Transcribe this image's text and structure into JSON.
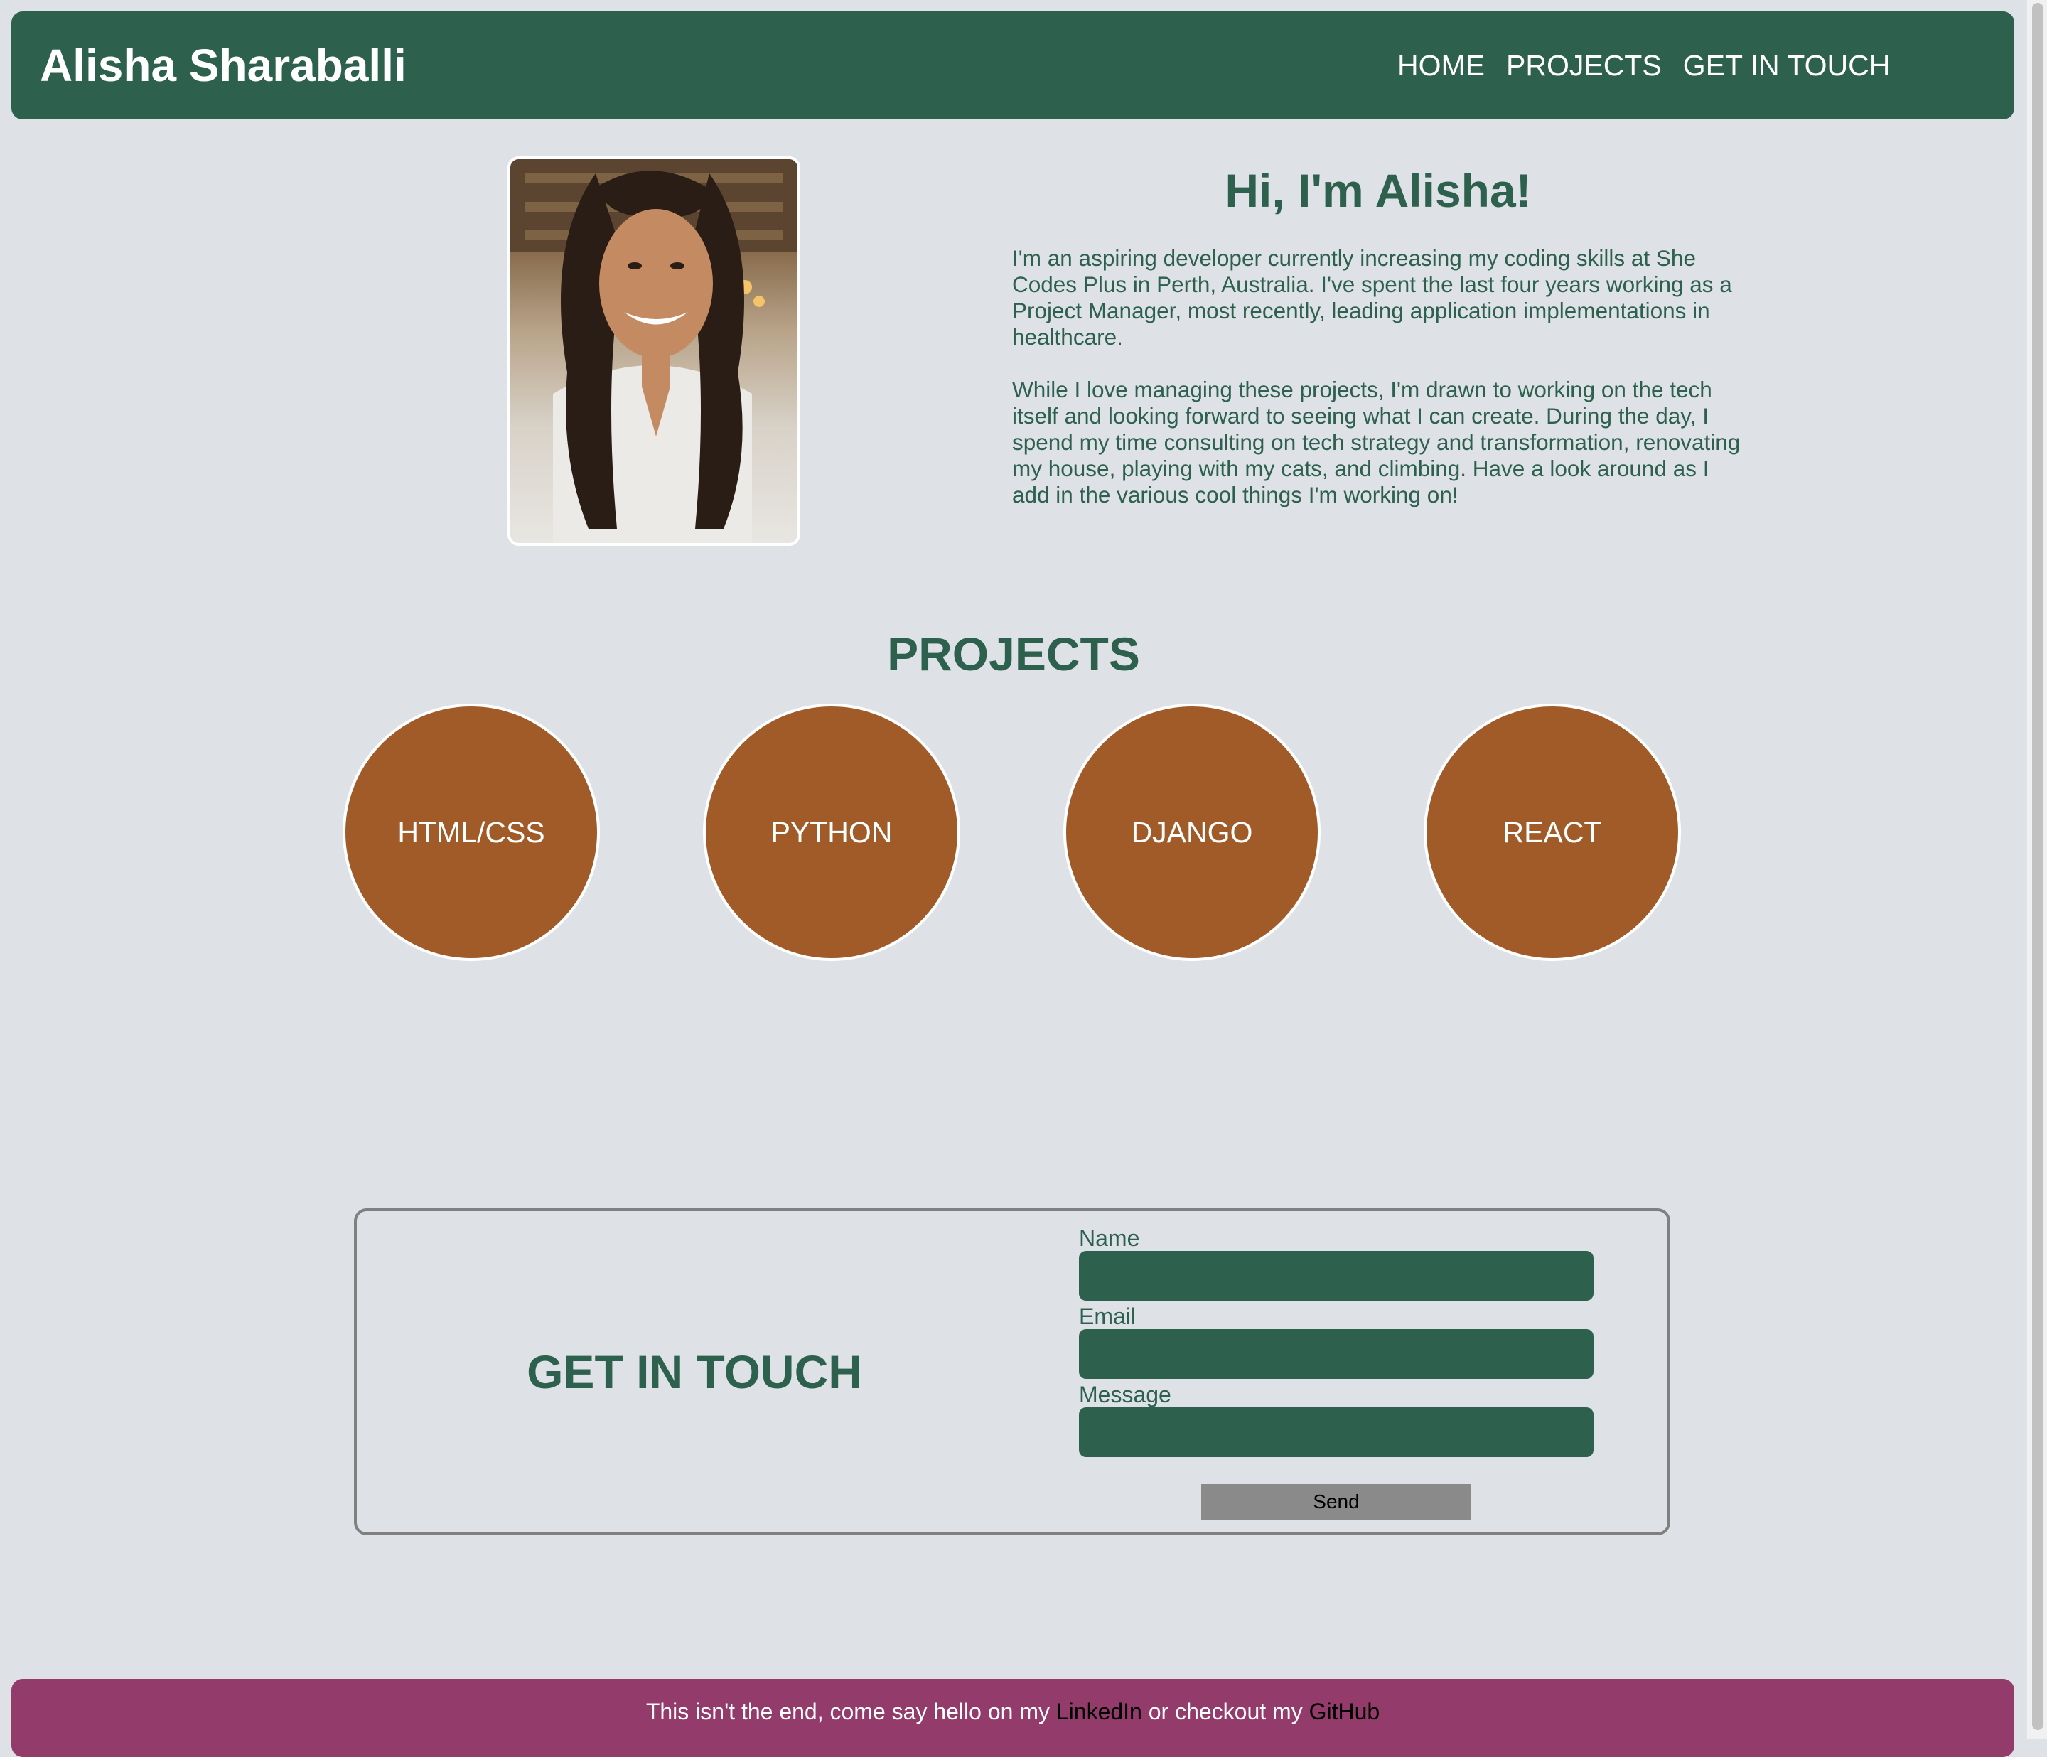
{
  "header": {
    "brand": "Alisha Sharaballi",
    "nav": [
      "HOME",
      "PROJECTS",
      "GET IN TOUCH"
    ]
  },
  "intro": {
    "heading": "Hi, I'm Alisha!",
    "paragraphs": [
      "I'm an aspiring developer currently increasing my coding skills at She Codes Plus in Perth, Australia. I've spent the last four years working as a Project Manager, most recently, leading application implementations in healthcare.",
      "While I love managing these projects, I'm drawn to working on the tech itself and looking forward to seeing what I can create. During the day, I spend my time consulting on tech strategy and transformation, renovating my house, playing with my cats, and climbing. Have a look around as I add in the various cool things I'm working on!"
    ]
  },
  "projects": {
    "title": "PROJECTS",
    "items": [
      "HTML/CSS",
      "PYTHON",
      "DJANGO",
      "REACT"
    ]
  },
  "contact": {
    "title": "GET IN TOUCH",
    "fields": {
      "name_label": "Name",
      "email_label": "Email",
      "message_label": "Message"
    },
    "send_label": "Send"
  },
  "footer": {
    "text_before": "This isn't the end, come say hello on my ",
    "linkedin": "LinkedIn",
    "text_middle": " or checkout my ",
    "github": "GitHub"
  },
  "colors": {
    "primary_green": "#2d614d",
    "bubble_brown": "#a15b28",
    "footer_magenta": "#933b6a",
    "page_background": "#dee2e6"
  }
}
